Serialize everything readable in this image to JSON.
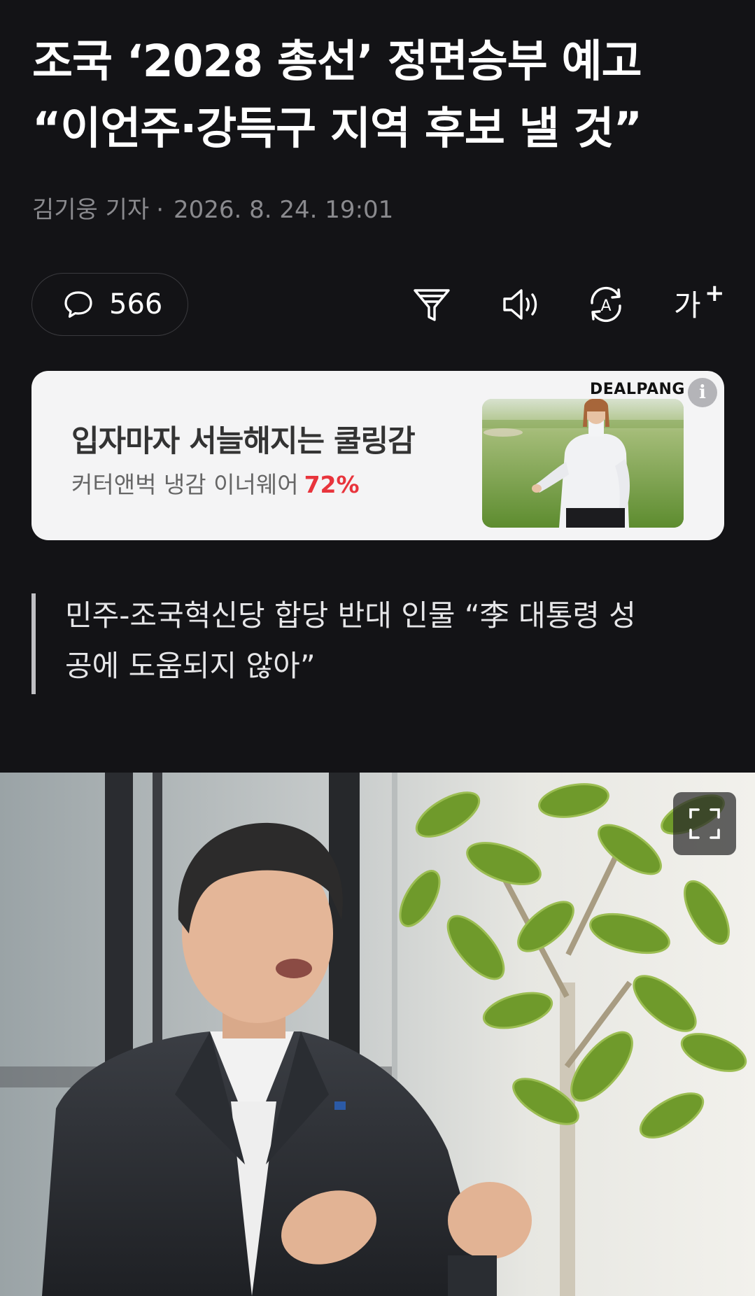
{
  "article": {
    "headline_line1": "조국 ‘2028 총선’ 정면승부 예고",
    "headline_line2": "“이언주·강득구 지역 후보 낼 것”",
    "author": "김기웅 기자",
    "separator": "·",
    "datetime": "2026. 8. 24. 19:01",
    "subheadline_line1": "민주-조국혁신당 합당 반대 인물 “李 대통령 성",
    "subheadline_line2": "공에 도움되지 않아”"
  },
  "toolbar": {
    "comment_count": "566",
    "icons": [
      "comment-icon",
      "summary-filter-icon",
      "speaker-icon",
      "translate-icon",
      "font-size-icon"
    ],
    "font_size_label": "가",
    "font_size_plus": "+",
    "translate_letter": "A"
  },
  "ad": {
    "title": "입자마자 서늘해지는 쿨링감",
    "subtitle": "커터앤벅 냉감 이너웨어",
    "discount": "72%",
    "brand": "DEALPANG",
    "info_symbol": "i",
    "discount_color": "#e8343c"
  },
  "colors": {
    "background": "#131316",
    "ad_background": "#f4f4f5"
  }
}
